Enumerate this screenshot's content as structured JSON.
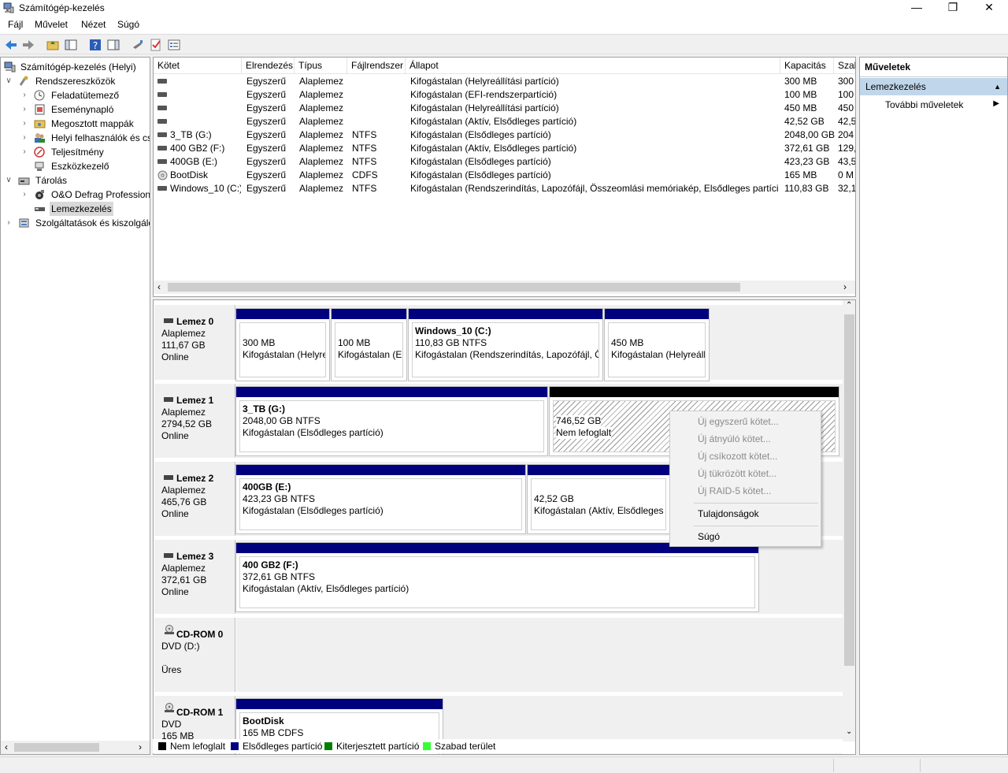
{
  "window": {
    "title": "Számítógép-kezelés"
  },
  "menu": [
    "Fájl",
    "Művelet",
    "Nézet",
    "Súgó"
  ],
  "tree": {
    "root": "Számítógép-kezelés (Helyi)",
    "system_tools": "Rendszereszközök",
    "task_scheduler": "Feladatütemező",
    "event_viewer": "Eseménynapló",
    "shared_folders": "Megosztott mappák",
    "local_users": "Helyi felhasználók és cs",
    "performance": "Teljesítmény",
    "device_manager": "Eszközkezelő",
    "storage": "Tárolás",
    "defrag": "O&O Defrag Profession",
    "disk_management": "Lemezkezelés",
    "services": "Szolgáltatások és kiszolgáló"
  },
  "volume_list": {
    "headers": [
      "Kötet",
      "Elrendezés",
      "Típus",
      "Fájlrendszer",
      "Állapot",
      "Kapacitás",
      "Szab"
    ],
    "rows": [
      {
        "name": "",
        "layout": "Egyszerű",
        "type": "Alaplemez",
        "fs": "",
        "status": "Kifogástalan (Helyreállítási partíció)",
        "capacity": "300 MB",
        "free": "300"
      },
      {
        "name": "",
        "layout": "Egyszerű",
        "type": "Alaplemez",
        "fs": "",
        "status": "Kifogástalan (EFI-rendszerpartíció)",
        "capacity": "100 MB",
        "free": "100"
      },
      {
        "name": "",
        "layout": "Egyszerű",
        "type": "Alaplemez",
        "fs": "",
        "status": "Kifogástalan (Helyreállítási partíció)",
        "capacity": "450 MB",
        "free": "450"
      },
      {
        "name": "",
        "layout": "Egyszerű",
        "type": "Alaplemez",
        "fs": "",
        "status": "Kifogástalan (Aktív, Elsődleges partíció)",
        "capacity": "42,52 GB",
        "free": "42,5"
      },
      {
        "name": "3_TB (G:)",
        "layout": "Egyszerű",
        "type": "Alaplemez",
        "fs": "NTFS",
        "status": "Kifogástalan (Elsődleges partíció)",
        "capacity": "2048,00 GB",
        "free": "204"
      },
      {
        "name": "400 GB2 (F:)",
        "layout": "Egyszerű",
        "type": "Alaplemez",
        "fs": "NTFS",
        "status": "Kifogástalan (Aktív, Elsődleges partíció)",
        "capacity": "372,61 GB",
        "free": "129,"
      },
      {
        "name": "400GB (E:)",
        "layout": "Egyszerű",
        "type": "Alaplemez",
        "fs": "NTFS",
        "status": "Kifogástalan (Elsődleges partíció)",
        "capacity": "423,23 GB",
        "free": "43,5"
      },
      {
        "name": "BootDisk",
        "layout": "Egyszerű",
        "type": "Alaplemez",
        "fs": "CDFS",
        "status": "Kifogástalan (Elsődleges partíció)",
        "capacity": "165 MB",
        "free": "0 M"
      },
      {
        "name": "Windows_10 (C:)",
        "layout": "Egyszerű",
        "type": "Alaplemez",
        "fs": "NTFS",
        "status": "Kifogástalan (Rendszerindítás, Lapozófájl, Összeomlási memóriakép, Elsődleges partíció)",
        "capacity": "110,83 GB",
        "free": "32,1"
      }
    ]
  },
  "disks": {
    "d0": {
      "name": "Lemez 0",
      "type": "Alaplemez",
      "size": "111,67 GB",
      "state": "Online",
      "p1": {
        "l1": "300 MB",
        "l2": "Kifogástalan (Helyre"
      },
      "p2": {
        "l1": "100 MB",
        "l2": "Kifogástalan (EF"
      },
      "p3": {
        "title": "Windows_10  (C:)",
        "l1": "110,83 GB NTFS",
        "l2": "Kifogástalan (Rendszerindítás, Lapozófájl, Ös"
      },
      "p4": {
        "l1": "450 MB",
        "l2": "Kifogástalan (Helyreáll"
      }
    },
    "d1": {
      "name": "Lemez 1",
      "type": "Alaplemez",
      "size": "2794,52 GB",
      "state": "Online",
      "p1": {
        "title": "3_TB  (G:)",
        "l1": "2048,00 GB NTFS",
        "l2": "Kifogástalan (Elsődleges partíció)"
      },
      "p2": {
        "l1": "746,52 GB",
        "l2": "Nem lefoglalt"
      }
    },
    "d2": {
      "name": "Lemez 2",
      "type": "Alaplemez",
      "size": "465,76 GB",
      "state": "Online",
      "p1": {
        "title": "400GB  (E:)",
        "l1": "423,23 GB NTFS",
        "l2": "Kifogástalan (Elsődleges partíció)"
      },
      "p2": {
        "l1": "42,52 GB",
        "l2": "Kifogástalan (Aktív, Elsődleges pa"
      }
    },
    "d3": {
      "name": "Lemez 3",
      "type": "Alaplemez",
      "size": "372,61 GB",
      "state": "Online",
      "p1": {
        "title": "400 GB2  (F:)",
        "l1": "372,61 GB NTFS",
        "l2": "Kifogástalan (Aktív, Elsődleges partíció)"
      }
    },
    "cd0": {
      "name": "CD-ROM 0",
      "type": "DVD (D:)",
      "state": "Üres"
    },
    "cd1": {
      "name": "CD-ROM 1",
      "type": "DVD",
      "size": "165 MB",
      "p1": {
        "title": "BootDisk",
        "l1": "165 MB CDFS"
      }
    }
  },
  "legend": {
    "unallocated": "Nem lefoglalt",
    "primary": "Elsődleges partíció",
    "extended": "Kiterjesztett partíció",
    "free": "Szabad terület",
    "colors": {
      "unallocated": "#000000",
      "primary": "#00007f",
      "extended": "#007f00",
      "free": "#33ff33"
    }
  },
  "actions": {
    "header": "Műveletek",
    "section": "Lemezkezelés",
    "more": "További műveletek"
  },
  "context_menu": {
    "simple": "Új egyszerű kötet...",
    "spanned": "Új átnyúló kötet...",
    "striped": "Új csíkozott kötet...",
    "mirrored": "Új tükrözött kötet...",
    "raid5": "Új RAID-5 kötet...",
    "properties": "Tulajdonságok",
    "help": "Súgó"
  }
}
